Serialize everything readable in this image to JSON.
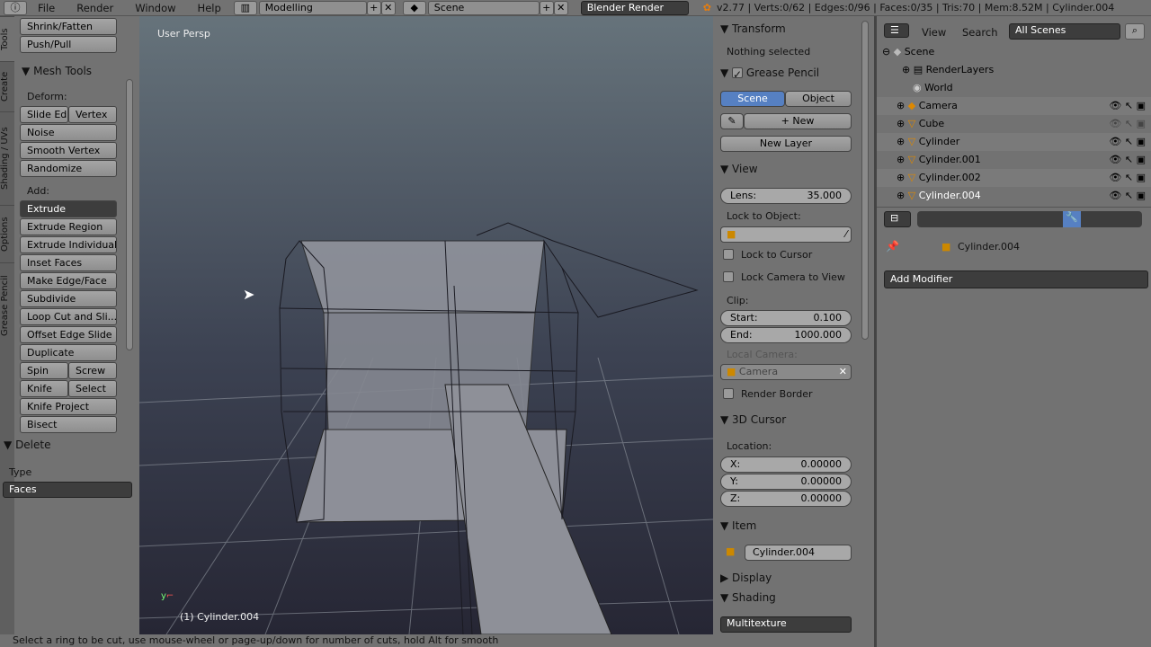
{
  "header": {
    "menus": [
      "File",
      "Render",
      "Window",
      "Help"
    ],
    "layout": "Modelling",
    "scene": "Scene",
    "engine": "Blender Render",
    "stats": "v2.77 | Verts:0/62 | Edges:0/96 | Faces:0/35 | Tris:70 | Mem:8.52M | Cylinder.004"
  },
  "tool_tabs": [
    "Tools",
    "Create",
    "Shading / UVs",
    "Options",
    "Grease Pencil"
  ],
  "tools": {
    "top_buttons": [
      "Shrink/Fatten",
      "Push/Pull"
    ],
    "mesh_tools_title": "Mesh Tools",
    "deform_label": "Deform:",
    "deform": [
      "Slide Ed",
      "Vertex",
      "Noise",
      "Smooth Vertex",
      "Randomize"
    ],
    "add_label": "Add:",
    "extrude_dropdown": "Extrude",
    "add": [
      "Extrude Region",
      "Extrude Individual",
      "Inset Faces",
      "Make Edge/Face",
      "Subdivide",
      "Loop Cut and Sli...",
      "Offset Edge Slide",
      "Duplicate",
      "Spin",
      "Screw",
      "Knife",
      "Select",
      "Knife Project",
      "Bisect"
    ],
    "delete_title": "Delete",
    "type_label": "Type",
    "type_value": "Faces"
  },
  "viewport": {
    "view_name": "User Persp",
    "object_label": "(1) Cylinder.004"
  },
  "npanel": {
    "transform_title": "Transform",
    "nothing_selected": "Nothing selected",
    "grease_title": "Grease Pencil",
    "grease_checked": true,
    "tab_scene": "Scene",
    "tab_object": "Object",
    "new_label": "New",
    "new_layer": "New Layer",
    "view_title": "View",
    "lens_label": "Lens:",
    "lens_value": "35.000",
    "lock_object_label": "Lock to Object:",
    "lock_cursor": "Lock to Cursor",
    "lock_camera": "Lock Camera to View",
    "clip_label": "Clip:",
    "start_label": "Start:",
    "start_value": "0.100",
    "end_label": "End:",
    "end_value": "1000.000",
    "local_camera_label": "Local Camera:",
    "local_camera_value": "Camera",
    "render_border": "Render Border",
    "cursor_title": "3D Cursor",
    "location_label": "Location:",
    "x_label": "X:",
    "x_value": "0.00000",
    "y_label": "Y:",
    "y_value": "0.00000",
    "z_label": "Z:",
    "z_value": "0.00000",
    "item_title": "Item",
    "item_name": "Cylinder.004",
    "display_title": "Display",
    "shading_title": "Shading",
    "shading_value": "Multitexture"
  },
  "outliner": {
    "view": "View",
    "search": "Search",
    "filter": "All Scenes",
    "rows": [
      "Scene",
      "RenderLayers",
      "World",
      "Camera",
      "Cube",
      "Cylinder",
      "Cylinder.001",
      "Cylinder.002",
      "Cylinder.004"
    ]
  },
  "properties": {
    "breadcrumb": "Cylinder.004",
    "add_modifier": "Add Modifier"
  },
  "status": "Select a ring to be cut, use mouse-wheel or page-up/down for number of cuts, hold Alt for smooth",
  "colors": {
    "accent": "#5680c2",
    "viewport_top": "#66737b",
    "viewport_bottom": "#262634",
    "panel": "#727272"
  }
}
